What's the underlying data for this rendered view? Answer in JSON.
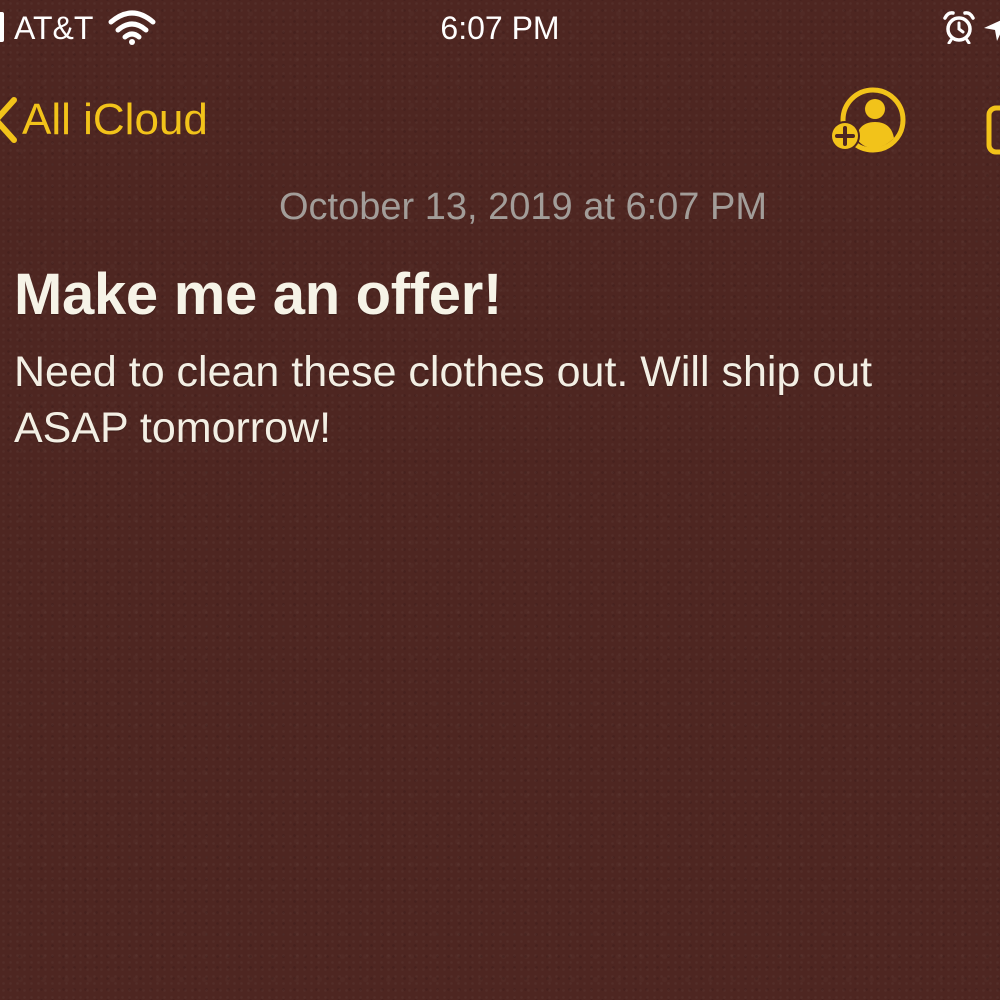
{
  "status_bar": {
    "carrier": "AT&T",
    "time": "6:07 PM",
    "icons": [
      "signal-icon",
      "wifi-icon",
      "alarm-icon",
      "location-icon"
    ]
  },
  "nav": {
    "back_label": "All iCloud",
    "icons": [
      "chevron-left-icon",
      "add-person-icon",
      "compose-icon"
    ]
  },
  "note": {
    "date": "October 13, 2019 at 6:07 PM",
    "title": "Make me an offer!",
    "body_lines": [
      "Need to clean these clothes out. Will ship out",
      "ASAP tomorrow!"
    ]
  },
  "colors": {
    "background": "#4e2621",
    "accent": "#f2c31a",
    "date_text": "#a29d99",
    "note_text": "#f6f3e7"
  }
}
